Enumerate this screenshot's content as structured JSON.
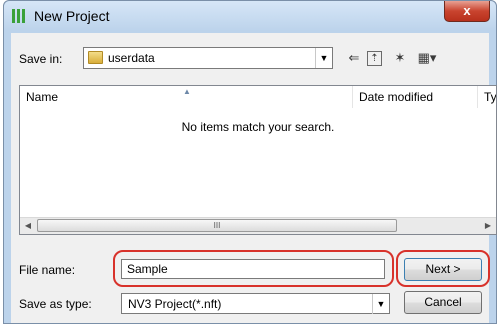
{
  "window": {
    "title": "New Project",
    "close_label": "x"
  },
  "toolbar": {
    "save_in_label": "Save in:",
    "save_in_value": "userdata",
    "icons": [
      "back-icon",
      "up-folder-icon",
      "new-folder-icon",
      "view-menu-icon"
    ]
  },
  "file_list": {
    "columns": [
      "Name",
      "Date modified",
      "Ty"
    ],
    "empty_message": "No items match your search.",
    "scroll_thumb": "III"
  },
  "form": {
    "file_name_label": "File name:",
    "file_name_value": "Sample",
    "save_as_type_label": "Save as type:",
    "save_as_type_value": "NV3 Project(*.nft)"
  },
  "buttons": {
    "next": "Next >",
    "cancel": "Cancel"
  },
  "colors": {
    "highlight": "#d8322b",
    "title_bar": "#bcd3eb",
    "close_button": "#c9442f"
  }
}
